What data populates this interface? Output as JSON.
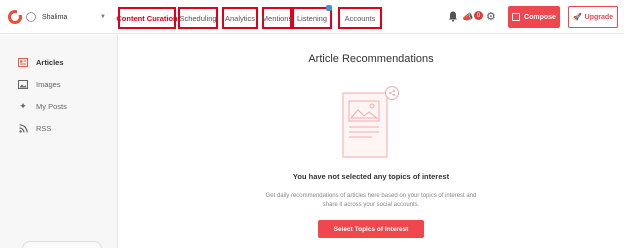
{
  "header": {
    "account_name": "Shalima",
    "tabs": [
      {
        "label": "Content Curation",
        "active": true
      },
      {
        "label": "Scheduling",
        "active": false
      },
      {
        "label": "Analytics",
        "active": false
      },
      {
        "label": "Mentions",
        "active": false
      },
      {
        "label": "Listening",
        "active": false
      },
      {
        "label": "Accounts",
        "active": false
      }
    ],
    "notification_badge": "0",
    "compose_label": "Compose",
    "upgrade_label": "Upgrade"
  },
  "sidebar": {
    "items": [
      {
        "label": "Articles",
        "icon": "articles-icon",
        "active": true
      },
      {
        "label": "Images",
        "icon": "image-icon",
        "active": false
      },
      {
        "label": "My Posts",
        "icon": "sparkle-icon",
        "active": false
      },
      {
        "label": "RSS",
        "icon": "rss-icon",
        "active": false
      }
    ]
  },
  "main": {
    "title": "Article Recommendations",
    "empty_title": "You have not selected any topics of interest",
    "empty_description": "Get daily recommendations of articles here based on your topics of interest and share it across your social accounts.",
    "cta_label": "Select Topics of Interest"
  },
  "colors": {
    "accent": "#f0474f",
    "highlight_border": "#e0001a"
  }
}
